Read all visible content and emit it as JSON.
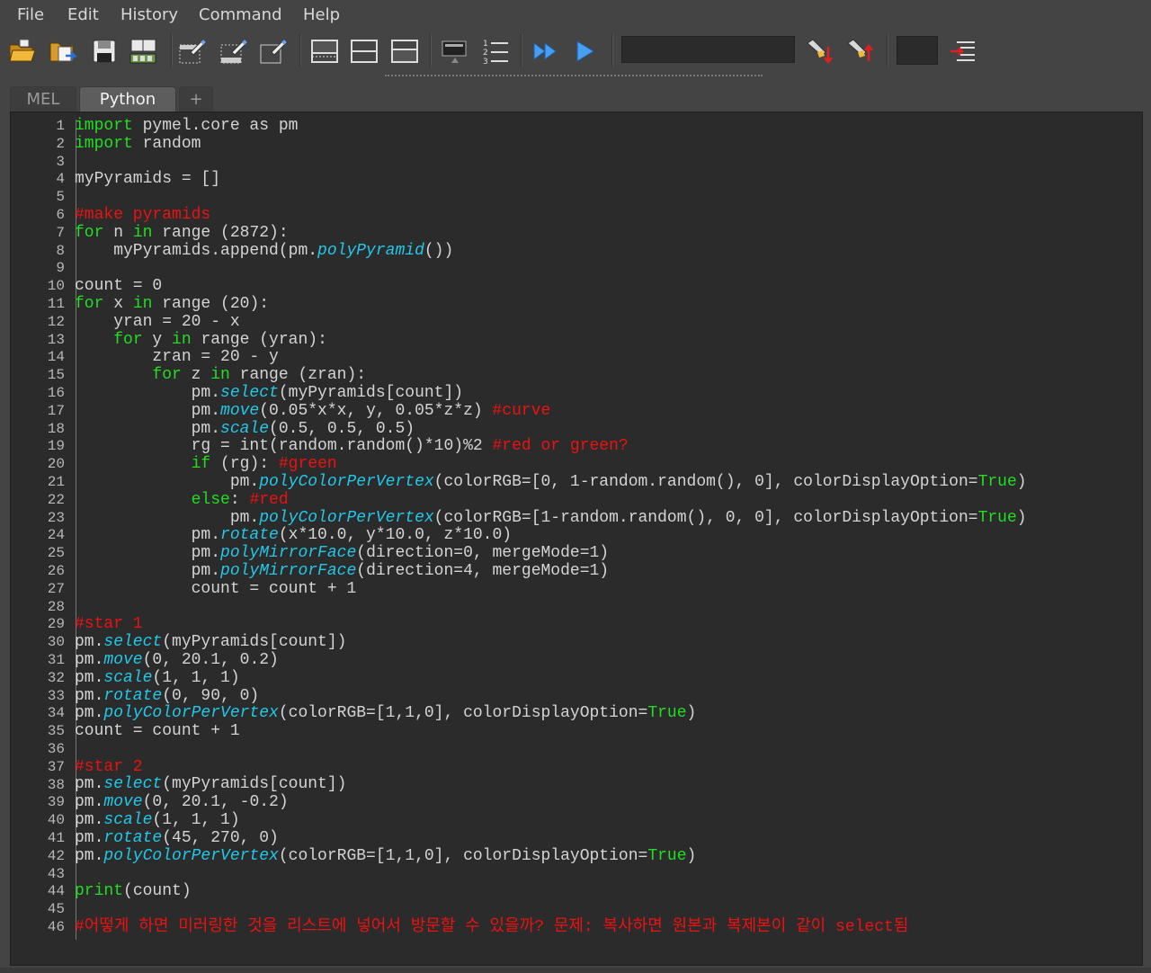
{
  "menu": {
    "items": [
      {
        "name": "menu-file",
        "label": "File"
      },
      {
        "name": "menu-edit",
        "label": "Edit"
      },
      {
        "name": "menu-history",
        "label": "History"
      },
      {
        "name": "menu-command",
        "label": "Command"
      },
      {
        "name": "menu-help",
        "label": "Help"
      }
    ]
  },
  "toolbar": {
    "buttons": [
      {
        "name": "open-script-icon"
      },
      {
        "name": "source-script-icon"
      },
      {
        "name": "save-script-icon"
      },
      {
        "name": "save-script-to-shelf-icon"
      },
      {
        "name": "clear-history-icon"
      },
      {
        "name": "clear-input-icon"
      },
      {
        "name": "clear-all-icon"
      },
      {
        "name": "show-history-only-icon"
      },
      {
        "name": "show-both-panels-icon"
      },
      {
        "name": "show-input-only-icon"
      },
      {
        "name": "echo-all-commands-icon"
      },
      {
        "name": "show-line-numbers-icon"
      },
      {
        "name": "execute-all-icon"
      },
      {
        "name": "execute-selected-icon"
      },
      {
        "name": "search-down-icon"
      },
      {
        "name": "search-up-icon"
      },
      {
        "name": "goto-line-icon"
      }
    ],
    "command_field_value": "",
    "line_number_value": ""
  },
  "tabs": [
    {
      "name": "tab-mel",
      "label": "MEL",
      "active": false
    },
    {
      "name": "tab-python",
      "label": "Python",
      "active": true
    },
    {
      "name": "tab-add",
      "label": "+",
      "active": false
    }
  ],
  "colors": {
    "keyword": "#22dd22",
    "function": "#22c8e8",
    "comment": "#ee1111",
    "text": "#d4d4d4",
    "editor_bg": "#2b2b2b"
  },
  "code_lines": [
    [
      [
        "kw",
        "import"
      ],
      [
        "tx",
        " pymel.core as pm"
      ]
    ],
    [
      [
        "kw",
        "import"
      ],
      [
        "tx",
        " random"
      ]
    ],
    [],
    [
      [
        "tx",
        "myPyramids = []"
      ]
    ],
    [],
    [
      [
        "cm",
        "#make pyramids"
      ]
    ],
    [
      [
        "kw",
        "for"
      ],
      [
        "tx",
        " n "
      ],
      [
        "kw",
        "in"
      ],
      [
        "tx",
        " range (2872):"
      ]
    ],
    [
      [
        "tx",
        "    myPyramids.append(pm."
      ],
      [
        "fn",
        "polyPyramid"
      ],
      [
        "tx",
        "())"
      ]
    ],
    [],
    [
      [
        "tx",
        "count = 0"
      ]
    ],
    [
      [
        "kw",
        "for"
      ],
      [
        "tx",
        " x "
      ],
      [
        "kw",
        "in"
      ],
      [
        "tx",
        " range (20):"
      ]
    ],
    [
      [
        "tx",
        "    yran = 20 - x"
      ]
    ],
    [
      [
        "tx",
        "    "
      ],
      [
        "kw",
        "for"
      ],
      [
        "tx",
        " y "
      ],
      [
        "kw",
        "in"
      ],
      [
        "tx",
        " range (yran):"
      ]
    ],
    [
      [
        "tx",
        "        zran = 20 - y"
      ]
    ],
    [
      [
        "tx",
        "        "
      ],
      [
        "kw",
        "for"
      ],
      [
        "tx",
        " z "
      ],
      [
        "kw",
        "in"
      ],
      [
        "tx",
        " range (zran):"
      ]
    ],
    [
      [
        "tx",
        "            pm."
      ],
      [
        "fn",
        "select"
      ],
      [
        "tx",
        "(myPyramids[count])"
      ]
    ],
    [
      [
        "tx",
        "            pm."
      ],
      [
        "fn",
        "move"
      ],
      [
        "tx",
        "(0.05*x*x, y, 0.05*z*z) "
      ],
      [
        "cm",
        "#curve"
      ]
    ],
    [
      [
        "tx",
        "            pm."
      ],
      [
        "fn",
        "scale"
      ],
      [
        "tx",
        "(0.5, 0.5, 0.5)"
      ]
    ],
    [
      [
        "tx",
        "            rg = int(random.random()*10)%2 "
      ],
      [
        "cm",
        "#red or green?"
      ]
    ],
    [
      [
        "tx",
        "            "
      ],
      [
        "kw",
        "if"
      ],
      [
        "tx",
        " (rg): "
      ],
      [
        "cm",
        "#green"
      ]
    ],
    [
      [
        "tx",
        "                pm."
      ],
      [
        "fn",
        "polyColorPerVertex"
      ],
      [
        "tx",
        "(colorRGB=[0, 1-random.random(), 0], colorDisplayOption="
      ],
      [
        "kw",
        "True"
      ],
      [
        "tx",
        ")"
      ]
    ],
    [
      [
        "tx",
        "            "
      ],
      [
        "kw",
        "else"
      ],
      [
        "tx",
        ": "
      ],
      [
        "cm",
        "#red"
      ]
    ],
    [
      [
        "tx",
        "                pm."
      ],
      [
        "fn",
        "polyColorPerVertex"
      ],
      [
        "tx",
        "(colorRGB=[1-random.random(), 0, 0], colorDisplayOption="
      ],
      [
        "kw",
        "True"
      ],
      [
        "tx",
        ")"
      ]
    ],
    [
      [
        "tx",
        "            pm."
      ],
      [
        "fn",
        "rotate"
      ],
      [
        "tx",
        "(x*10.0, y*10.0, z*10.0)"
      ]
    ],
    [
      [
        "tx",
        "            pm."
      ],
      [
        "fn",
        "polyMirrorFace"
      ],
      [
        "tx",
        "(direction=0, mergeMode=1)"
      ]
    ],
    [
      [
        "tx",
        "            pm."
      ],
      [
        "fn",
        "polyMirrorFace"
      ],
      [
        "tx",
        "(direction=4, mergeMode=1)"
      ]
    ],
    [
      [
        "tx",
        "            count = count + 1"
      ]
    ],
    [],
    [
      [
        "cm",
        "#star 1"
      ]
    ],
    [
      [
        "tx",
        "pm."
      ],
      [
        "fn",
        "select"
      ],
      [
        "tx",
        "(myPyramids[count])"
      ]
    ],
    [
      [
        "tx",
        "pm."
      ],
      [
        "fn",
        "move"
      ],
      [
        "tx",
        "(0, 20.1, 0.2)"
      ]
    ],
    [
      [
        "tx",
        "pm."
      ],
      [
        "fn",
        "scale"
      ],
      [
        "tx",
        "(1, 1, 1)"
      ]
    ],
    [
      [
        "tx",
        "pm."
      ],
      [
        "fn",
        "rotate"
      ],
      [
        "tx",
        "(0, 90, 0)"
      ]
    ],
    [
      [
        "tx",
        "pm."
      ],
      [
        "fn",
        "polyColorPerVertex"
      ],
      [
        "tx",
        "(colorRGB=[1,1,0], colorDisplayOption="
      ],
      [
        "kw",
        "True"
      ],
      [
        "tx",
        ")"
      ]
    ],
    [
      [
        "tx",
        "count = count + 1"
      ]
    ],
    [],
    [
      [
        "cm",
        "#star 2"
      ]
    ],
    [
      [
        "tx",
        "pm."
      ],
      [
        "fn",
        "select"
      ],
      [
        "tx",
        "(myPyramids[count])"
      ]
    ],
    [
      [
        "tx",
        "pm."
      ],
      [
        "fn",
        "move"
      ],
      [
        "tx",
        "(0, 20.1, -0.2)"
      ]
    ],
    [
      [
        "tx",
        "pm."
      ],
      [
        "fn",
        "scale"
      ],
      [
        "tx",
        "(1, 1, 1)"
      ]
    ],
    [
      [
        "tx",
        "pm."
      ],
      [
        "fn",
        "rotate"
      ],
      [
        "tx",
        "(45, 270, 0)"
      ]
    ],
    [
      [
        "tx",
        "pm."
      ],
      [
        "fn",
        "polyColorPerVertex"
      ],
      [
        "tx",
        "(colorRGB=[1,1,0], colorDisplayOption="
      ],
      [
        "kw",
        "True"
      ],
      [
        "tx",
        ")"
      ]
    ],
    [],
    [
      [
        "bi",
        "print"
      ],
      [
        "tx",
        "(count)"
      ]
    ],
    [],
    [
      [
        "cm",
        "#어떻게 하면 미러링한 것을 리스트에 넣어서 방문할 수 있을까? 문제: 복사하면 원본과 복제본이 같이 select됨"
      ]
    ]
  ]
}
